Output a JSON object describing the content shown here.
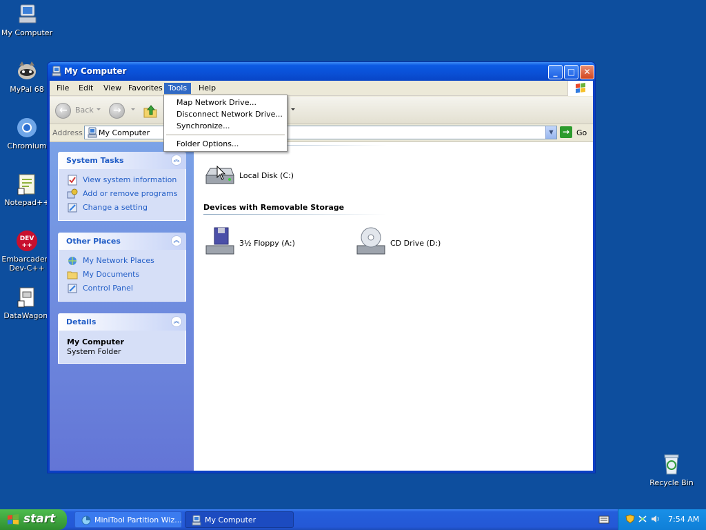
{
  "desktop": {
    "icons": [
      {
        "name": "my-computer",
        "label": "My Computer"
      },
      {
        "name": "mypal",
        "label": "MyPal 68"
      },
      {
        "name": "chromium",
        "label": "Chromium"
      },
      {
        "name": "notepadpp",
        "label": "Notepad++"
      },
      {
        "name": "devcpp",
        "label": "Embarcadero Dev-C++"
      },
      {
        "name": "datawagon",
        "label": "DataWagon."
      },
      {
        "name": "recycle-bin",
        "label": "Recycle Bin"
      }
    ],
    "devcpp_line1": "Embarcadero",
    "devcpp_line2": "Dev-C++"
  },
  "window": {
    "title": "My Computer",
    "menu": [
      "File",
      "Edit",
      "View",
      "Favorites",
      "Tools",
      "Help"
    ],
    "active_menu": "Tools",
    "toolbar": {
      "back_label": "Back"
    },
    "address": {
      "label": "Address",
      "value": "My Computer",
      "go_label": "Go"
    }
  },
  "tools_menu": {
    "items": [
      "Map Network Drive...",
      "Disconnect Network Drive...",
      "Synchronize...",
      "Folder Options..."
    ]
  },
  "taskpane": {
    "system_tasks": {
      "title": "System Tasks",
      "links": [
        "View system information",
        "Add or remove programs",
        "Change a setting"
      ]
    },
    "other_places": {
      "title": "Other Places",
      "links": [
        "My Network Places",
        "My Documents",
        "Control Panel"
      ]
    },
    "details": {
      "title": "Details",
      "name": "My Computer",
      "type": "System Folder"
    }
  },
  "files": {
    "hard_disk_items": [
      {
        "label": "Local Disk (C:)"
      }
    ],
    "removable_group_title": "Devices with Removable Storage",
    "removable_items": [
      {
        "label": "3½ Floppy (A:)"
      },
      {
        "label": "CD Drive (D:)"
      }
    ]
  },
  "taskbar": {
    "start_label": "start",
    "tasks": [
      {
        "label": "MiniTool Partition Wiz...",
        "active": false
      },
      {
        "label": "My Computer",
        "active": true
      }
    ],
    "clock": "7:54 AM"
  },
  "colors": {
    "desktop": "#0d4e9e",
    "titlebar": "#0b5ae3",
    "link": "#215dc6",
    "menu_highlight": "#316ac5"
  }
}
